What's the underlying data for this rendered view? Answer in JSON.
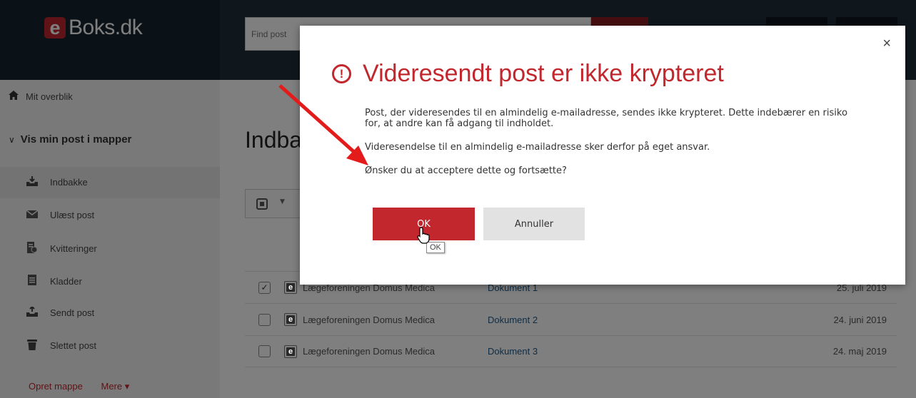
{
  "header": {
    "logo_letter": "e",
    "logo_text": "Boks.dk",
    "search_placeholder": "Find post"
  },
  "sidebar": {
    "overview": "Mit overblik",
    "folders_heading": "Vis min post i mapper",
    "folders": [
      {
        "label": "Indbakke",
        "icon": "inbox-download-icon"
      },
      {
        "label": "Ulæst post",
        "icon": "envelope-icon"
      },
      {
        "label": "Kvitteringer",
        "icon": "receipt-icon"
      },
      {
        "label": "Kladder",
        "icon": "draft-document-icon"
      },
      {
        "label": "Sendt post",
        "icon": "outbox-upload-icon"
      },
      {
        "label": "Slettet post",
        "icon": "trash-icon"
      }
    ],
    "create_folder": "Opret mappe",
    "more": "Mere ▾"
  },
  "main": {
    "title": "Indbakke",
    "rows": [
      {
        "checked": true,
        "sender": "Lægeforeningen Domus Medica",
        "document": "Dokument 1",
        "date": "25. juli 2019"
      },
      {
        "checked": false,
        "sender": "Lægeforeningen Domus Medica",
        "document": "Dokument 2",
        "date": "24. juni 2019"
      },
      {
        "checked": false,
        "sender": "Lægeforeningen Domus Medica",
        "document": "Dokument 3",
        "date": "24. maj 2019"
      }
    ]
  },
  "dialog": {
    "title": "Videresendt post er ikke krypteret",
    "paragraph1": "Post, der videresendes til en almindelig e-mailadresse, sendes ikke krypteret. Dette indebærer en risiko for, at andre kan få adgang til indholdet.",
    "paragraph2": "Videresendelse til en almindelig e-mailadresse sker derfor på eget ansvar.",
    "paragraph3": "Ønsker du at acceptere dette og fortsætte?",
    "ok_label": "OK",
    "cancel_label": "Annuller",
    "tooltip": "OK",
    "close_symbol": "×"
  },
  "colors": {
    "brand_red": "#c1272d",
    "header_dark": "#16242e",
    "annotation_arrow": "#e41b1b"
  }
}
